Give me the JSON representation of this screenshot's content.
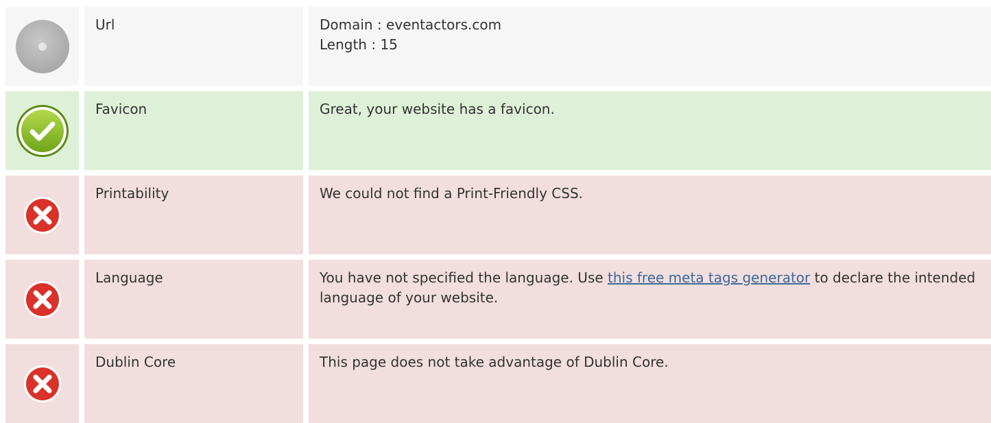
{
  "rows": [
    {
      "status": "neutral",
      "icon": "neutral-circle-icon",
      "name": "Url",
      "lines": [
        "Domain : eventactors.com",
        "Length : 15"
      ]
    },
    {
      "status": "success",
      "icon": "checkmark-icon",
      "name": "Favicon",
      "text": "Great, your website has a favicon."
    },
    {
      "status": "error",
      "icon": "error-x-icon",
      "name": "Printability",
      "text": "We could not find a Print-Friendly CSS."
    },
    {
      "status": "error",
      "icon": "error-x-icon",
      "name": "Language",
      "text_before": "You have not specified the language. Use ",
      "link_text": "this free meta tags generator",
      "text_after": " to declare the intended language of your website."
    },
    {
      "status": "error",
      "icon": "error-x-icon",
      "name": "Dublin Core",
      "text": "This page does not take advantage of Dublin Core."
    }
  ],
  "colors": {
    "neutral_bg": "#f6f6f6",
    "success_bg": "#dff0d8",
    "error_bg": "#f2dede",
    "link": "#3b6a99",
    "text": "#333333"
  }
}
